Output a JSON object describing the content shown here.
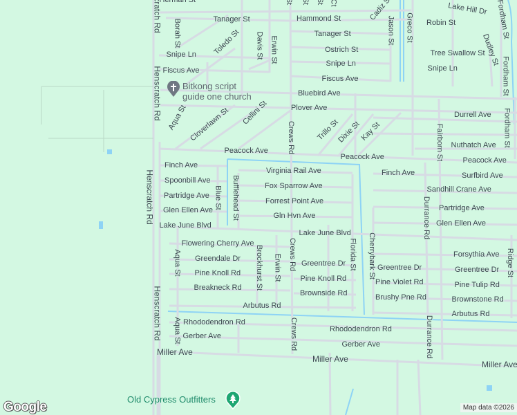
{
  "colors": {
    "land": "#d3f8e2",
    "road": "#d7dbe4",
    "water": "#8ed3f5",
    "label": "#3c4650",
    "park": "#1ea672"
  },
  "streets": [
    "Herman St",
    "Tanager St",
    "Hammond St",
    "Tanager St",
    "Ostrich St",
    "Snipe Ln",
    "Fiscus Ave",
    "Bluebird Ave",
    "Plover Ave",
    "Snipe Ln",
    "Fiscus Ave",
    "Lake Hill Dr",
    "Robin St",
    "Tree Swallow St",
    "Snipe Ln",
    "Durrell Ave",
    "Nuthatch Ave",
    "Peacock Ave",
    "Peacock Ave",
    "Peacock Ave",
    "Finch Ave",
    "Virginia Rail Ave",
    "Finch Ave",
    "Surfbird Ave",
    "Spoonbill Ave",
    "Fox Sparrow Ave",
    "Sandhill Crane Ave",
    "Partridge Ave",
    "Forrest Point Ave",
    "Partridge Ave",
    "Glen Ellen Ave",
    "Gln Hvn Ave",
    "Glen Ellen Ave",
    "Lake June Blvd",
    "Lake June Blvd",
    "Flowering Cherry Ave",
    "Forsythia Ave",
    "Greendale Dr",
    "Greentree Dr",
    "Greentree Dr",
    "Greentree Dr",
    "Pine Knoll Rd",
    "Pine Knoll Rd",
    "Pine Violet Rd",
    "Pine Tulip Rd",
    "Breakneck Rd",
    "Brownside Rd",
    "Brushy Pne Rd",
    "Brownstone Rd",
    "Arbutus Rd",
    "Arbutus Rd",
    "Rhododendron Rd",
    "Rhododendron Rd",
    "Gerber Ave",
    "Gerber Ave",
    "Miller Ave",
    "Miller Ave",
    "Miller Ave",
    "Henscratch Rd",
    "Henscratch Rd",
    "Henscratch Rd",
    "Henscratch Rd",
    "Borah St",
    "Toledo St",
    "Davis St",
    "Erwin St",
    "Jason St",
    "Greco St",
    "Dudley St",
    "Fordham St",
    "Fordham St",
    "Fordham St",
    "Aqua St",
    "Cloverlawn St",
    "Cellini St",
    "Crews Rd",
    "Trillo St",
    "Dixie St",
    "Kay St",
    "Fairborn St",
    "Blue St",
    "Bufflehead St",
    "Durrance Rd",
    "Cherrybark St",
    "Florida St",
    "Crews Rd",
    "Aqua St",
    "Brockhurst St",
    "Erwin St",
    "Ridge St",
    "Durrance Rd",
    "Crews Rd",
    "Aqua St",
    "Cadiz St",
    "Ct",
    "St",
    "St",
    "St"
  ],
  "pois": {
    "church_line1": "Bitkong script",
    "church_line2": "guide one church",
    "outfitters": "Old Cypress Outfitters"
  },
  "footer": {
    "logo": "Google",
    "attribution": "Map data ©2026"
  }
}
